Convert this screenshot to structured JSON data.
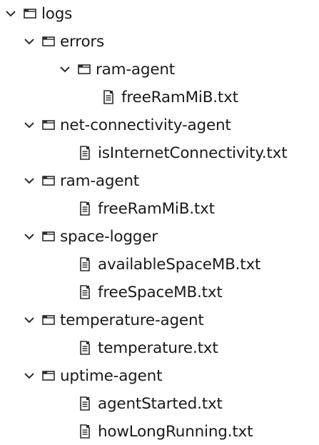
{
  "colors": {
    "text": "#1a1a1a",
    "icon": "#2b2b2b",
    "background": "#ffffff"
  },
  "tree": {
    "root": {
      "name": "logs",
      "icon": "folder-icon",
      "expanded": true
    },
    "errors": {
      "name": "errors",
      "icon": "folder-icon",
      "expanded": true
    },
    "errors_ram_agent": {
      "name": "ram-agent",
      "icon": "folder-icon",
      "expanded": true
    },
    "errors_ram_agent_file": {
      "name": "freeRamMiB.txt",
      "icon": "text-file-icon"
    },
    "net_agent": {
      "name": "net-connectivity-agent",
      "icon": "folder-icon",
      "expanded": true
    },
    "net_agent_file": {
      "name": "isInternetConnectivity.txt",
      "icon": "text-file-icon"
    },
    "ram_agent": {
      "name": "ram-agent",
      "icon": "folder-icon",
      "expanded": true
    },
    "ram_agent_file": {
      "name": "freeRamMiB.txt",
      "icon": "text-file-icon"
    },
    "space_logger": {
      "name": "space-logger",
      "icon": "folder-icon",
      "expanded": true
    },
    "space_logger_file1": {
      "name": "availableSpaceMB.txt",
      "icon": "text-file-icon"
    },
    "space_logger_file2": {
      "name": "freeSpaceMB.txt",
      "icon": "text-file-icon"
    },
    "temperature_agent": {
      "name": "temperature-agent",
      "icon": "folder-icon",
      "expanded": true
    },
    "temperature_agent_file": {
      "name": "temperature.txt",
      "icon": "text-file-icon"
    },
    "uptime_agent": {
      "name": "uptime-agent",
      "icon": "folder-icon",
      "expanded": true
    },
    "uptime_agent_file1": {
      "name": "agentStarted.txt",
      "icon": "text-file-icon"
    },
    "uptime_agent_file2": {
      "name": "howLongRunning.txt",
      "icon": "text-file-icon"
    }
  }
}
